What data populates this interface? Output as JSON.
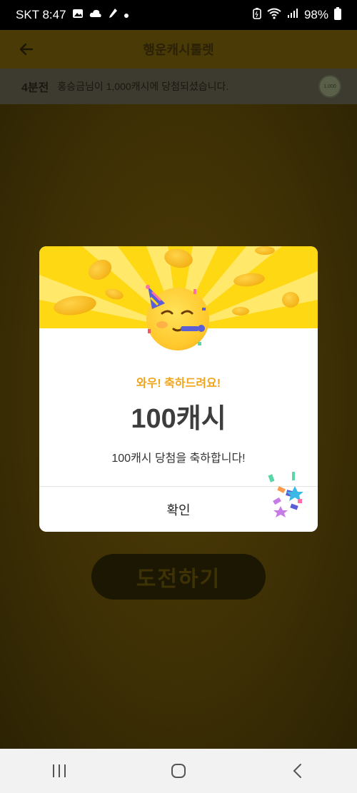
{
  "status_bar": {
    "carrier_time": "SKT 8:47",
    "battery": "98%"
  },
  "header": {
    "title": "행운캐시룰렛"
  },
  "notice": {
    "time_ago": "4분전",
    "message": "홍승금님이 1,000캐시에 당첨되셨습니다.",
    "coin_label": "1,000"
  },
  "main": {
    "challenge_label": "도전하기"
  },
  "dialog": {
    "subtitle": "와우! 축하드려요!",
    "amount": "100캐시",
    "message": "100캐시 당첨을 축하합니다!",
    "confirm_label": "확인"
  },
  "nav": {
    "recent": "recent-apps-icon",
    "home": "home-icon",
    "back": "back-icon"
  },
  "colors": {
    "accent_yellow": "#ffd814",
    "subtitle_orange": "#f0a419"
  }
}
